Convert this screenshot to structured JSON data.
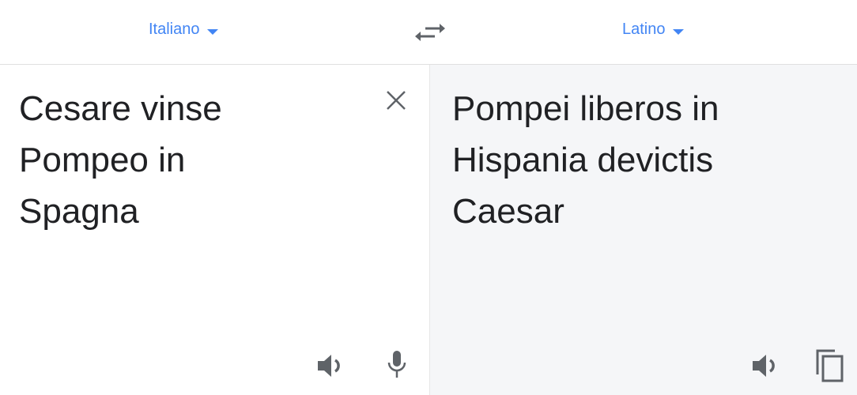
{
  "header": {
    "source_language": "Italiano",
    "target_language": "Latino",
    "swap_icon": "swap-arrows-icon"
  },
  "source": {
    "text": "Cesare vinse\nPompeo in\nSpagna",
    "icons": [
      "close-icon",
      "speaker-icon",
      "microphone-icon"
    ]
  },
  "translation": {
    "text": "Pompei liberos in\nHispania devictis\nCaesar",
    "icons": [
      "speaker-icon",
      "copy-icon"
    ]
  },
  "colors": {
    "accent": "#4285f4",
    "text": "#202124",
    "icon": "#5f6368",
    "translation_bg": "#f5f6f8"
  }
}
